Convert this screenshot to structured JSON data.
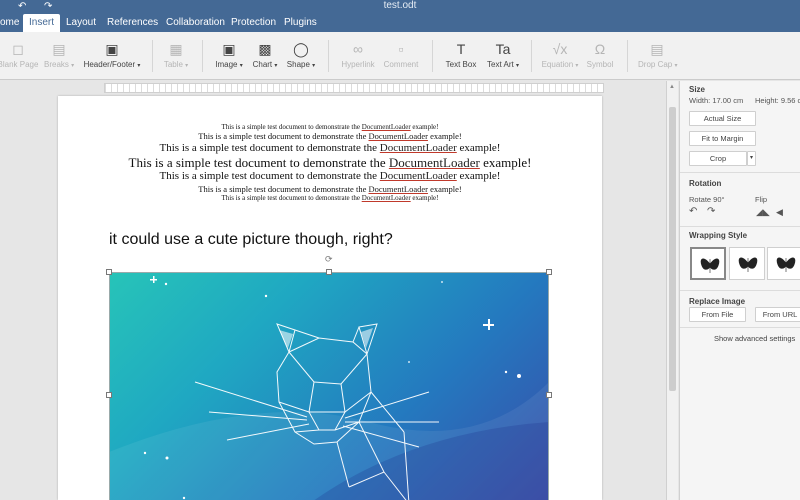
{
  "window": {
    "title": "test.odt"
  },
  "quick_access": {
    "undo_icon": "undo-icon",
    "redo_icon": "redo-icon"
  },
  "tabs": [
    "ome",
    "Insert",
    "Layout",
    "References",
    "Collaboration",
    "Protection",
    "Plugins"
  ],
  "active_tab": "Insert",
  "toolbar": {
    "blank_page": "Blank Page",
    "breaks": "Breaks",
    "header_footer": "Header/Footer",
    "table": "Table",
    "image": "Image",
    "chart": "Chart",
    "shape": "Shape",
    "hyperlink": "Hyperlink",
    "comment": "Comment",
    "text_box": "Text Box",
    "text_art": "Text Art",
    "equation": "Equation",
    "symbol": "Symbol",
    "drop_cap": "Drop Cap"
  },
  "document": {
    "lines": [
      {
        "before": "This is a simple test document to demonstrate the ",
        "link": "DocumentLoader",
        "after": " example!",
        "size": 7
      },
      {
        "before": "This is a simple test document to demonstrate the ",
        "link": "DocumentLoader",
        "after": " example!",
        "size": 8.5
      },
      {
        "before": "This is a simple test document to demonstrate the ",
        "link": "DocumentLoader",
        "after": " example!",
        "size": 11
      },
      {
        "before": "This is a simple test document to demonstrate the ",
        "link": "DocumentLoader",
        "after": " example!",
        "size": 13
      },
      {
        "before": "This is a simple test document to demonstrate the ",
        "link": "DocumentLoader",
        "after": " example!",
        "size": 11
      },
      {
        "before": "This is a simple test document to demonstrate the ",
        "link": "DocumentLoader",
        "after": " example!",
        "size": 8.5
      },
      {
        "before": "This is a simple test document to demonstrate the ",
        "link": "DocumentLoader",
        "after": " example!",
        "size": 7
      }
    ],
    "heading": "it could use a cute picture though, right?"
  },
  "panel": {
    "size_title": "Size",
    "width_text": "Width: 17.00 cm",
    "height_text": "Height: 9.56 c",
    "actual_size": "Actual Size",
    "fit_to_margin": "Fit to Margin",
    "crop": "Crop",
    "rotation_title": "Rotation",
    "rotate_label": "Rotate 90°",
    "flip_label": "Flip",
    "wrapping_title": "Wrapping Style",
    "replace_title": "Replace Image",
    "from_file": "From File",
    "from_url": "From URL",
    "advanced": "Show advanced settings"
  },
  "colors": {
    "accent": "#446995",
    "image_start": "#27c4b8",
    "image_end": "#3a4ba8"
  }
}
